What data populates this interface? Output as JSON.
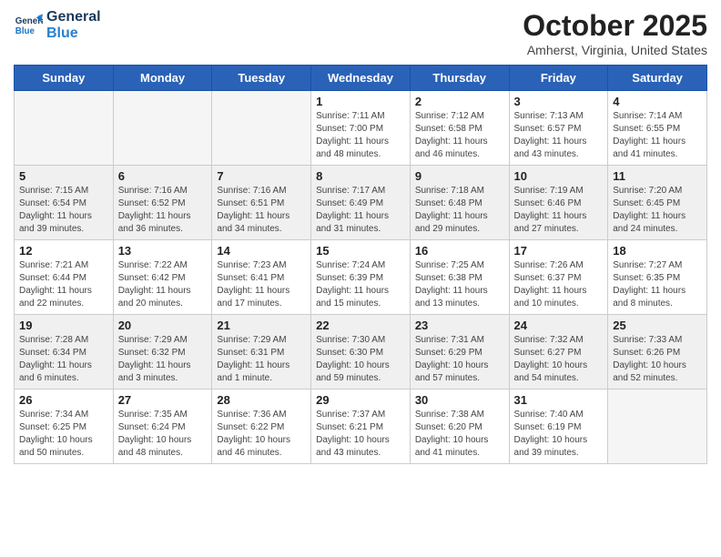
{
  "logo": {
    "line1": "General",
    "line2": "Blue"
  },
  "header": {
    "month": "October 2025",
    "location": "Amherst, Virginia, United States"
  },
  "weekdays": [
    "Sunday",
    "Monday",
    "Tuesday",
    "Wednesday",
    "Thursday",
    "Friday",
    "Saturday"
  ],
  "weeks": [
    [
      {
        "day": "",
        "info": ""
      },
      {
        "day": "",
        "info": ""
      },
      {
        "day": "",
        "info": ""
      },
      {
        "day": "1",
        "info": "Sunrise: 7:11 AM\nSunset: 7:00 PM\nDaylight: 11 hours and 48 minutes."
      },
      {
        "day": "2",
        "info": "Sunrise: 7:12 AM\nSunset: 6:58 PM\nDaylight: 11 hours and 46 minutes."
      },
      {
        "day": "3",
        "info": "Sunrise: 7:13 AM\nSunset: 6:57 PM\nDaylight: 11 hours and 43 minutes."
      },
      {
        "day": "4",
        "info": "Sunrise: 7:14 AM\nSunset: 6:55 PM\nDaylight: 11 hours and 41 minutes."
      }
    ],
    [
      {
        "day": "5",
        "info": "Sunrise: 7:15 AM\nSunset: 6:54 PM\nDaylight: 11 hours and 39 minutes."
      },
      {
        "day": "6",
        "info": "Sunrise: 7:16 AM\nSunset: 6:52 PM\nDaylight: 11 hours and 36 minutes."
      },
      {
        "day": "7",
        "info": "Sunrise: 7:16 AM\nSunset: 6:51 PM\nDaylight: 11 hours and 34 minutes."
      },
      {
        "day": "8",
        "info": "Sunrise: 7:17 AM\nSunset: 6:49 PM\nDaylight: 11 hours and 31 minutes."
      },
      {
        "day": "9",
        "info": "Sunrise: 7:18 AM\nSunset: 6:48 PM\nDaylight: 11 hours and 29 minutes."
      },
      {
        "day": "10",
        "info": "Sunrise: 7:19 AM\nSunset: 6:46 PM\nDaylight: 11 hours and 27 minutes."
      },
      {
        "day": "11",
        "info": "Sunrise: 7:20 AM\nSunset: 6:45 PM\nDaylight: 11 hours and 24 minutes."
      }
    ],
    [
      {
        "day": "12",
        "info": "Sunrise: 7:21 AM\nSunset: 6:44 PM\nDaylight: 11 hours and 22 minutes."
      },
      {
        "day": "13",
        "info": "Sunrise: 7:22 AM\nSunset: 6:42 PM\nDaylight: 11 hours and 20 minutes."
      },
      {
        "day": "14",
        "info": "Sunrise: 7:23 AM\nSunset: 6:41 PM\nDaylight: 11 hours and 17 minutes."
      },
      {
        "day": "15",
        "info": "Sunrise: 7:24 AM\nSunset: 6:39 PM\nDaylight: 11 hours and 15 minutes."
      },
      {
        "day": "16",
        "info": "Sunrise: 7:25 AM\nSunset: 6:38 PM\nDaylight: 11 hours and 13 minutes."
      },
      {
        "day": "17",
        "info": "Sunrise: 7:26 AM\nSunset: 6:37 PM\nDaylight: 11 hours and 10 minutes."
      },
      {
        "day": "18",
        "info": "Sunrise: 7:27 AM\nSunset: 6:35 PM\nDaylight: 11 hours and 8 minutes."
      }
    ],
    [
      {
        "day": "19",
        "info": "Sunrise: 7:28 AM\nSunset: 6:34 PM\nDaylight: 11 hours and 6 minutes."
      },
      {
        "day": "20",
        "info": "Sunrise: 7:29 AM\nSunset: 6:32 PM\nDaylight: 11 hours and 3 minutes."
      },
      {
        "day": "21",
        "info": "Sunrise: 7:29 AM\nSunset: 6:31 PM\nDaylight: 11 hours and 1 minute."
      },
      {
        "day": "22",
        "info": "Sunrise: 7:30 AM\nSunset: 6:30 PM\nDaylight: 10 hours and 59 minutes."
      },
      {
        "day": "23",
        "info": "Sunrise: 7:31 AM\nSunset: 6:29 PM\nDaylight: 10 hours and 57 minutes."
      },
      {
        "day": "24",
        "info": "Sunrise: 7:32 AM\nSunset: 6:27 PM\nDaylight: 10 hours and 54 minutes."
      },
      {
        "day": "25",
        "info": "Sunrise: 7:33 AM\nSunset: 6:26 PM\nDaylight: 10 hours and 52 minutes."
      }
    ],
    [
      {
        "day": "26",
        "info": "Sunrise: 7:34 AM\nSunset: 6:25 PM\nDaylight: 10 hours and 50 minutes."
      },
      {
        "day": "27",
        "info": "Sunrise: 7:35 AM\nSunset: 6:24 PM\nDaylight: 10 hours and 48 minutes."
      },
      {
        "day": "28",
        "info": "Sunrise: 7:36 AM\nSunset: 6:22 PM\nDaylight: 10 hours and 46 minutes."
      },
      {
        "day": "29",
        "info": "Sunrise: 7:37 AM\nSunset: 6:21 PM\nDaylight: 10 hours and 43 minutes."
      },
      {
        "day": "30",
        "info": "Sunrise: 7:38 AM\nSunset: 6:20 PM\nDaylight: 10 hours and 41 minutes."
      },
      {
        "day": "31",
        "info": "Sunrise: 7:40 AM\nSunset: 6:19 PM\nDaylight: 10 hours and 39 minutes."
      },
      {
        "day": "",
        "info": ""
      }
    ]
  ]
}
